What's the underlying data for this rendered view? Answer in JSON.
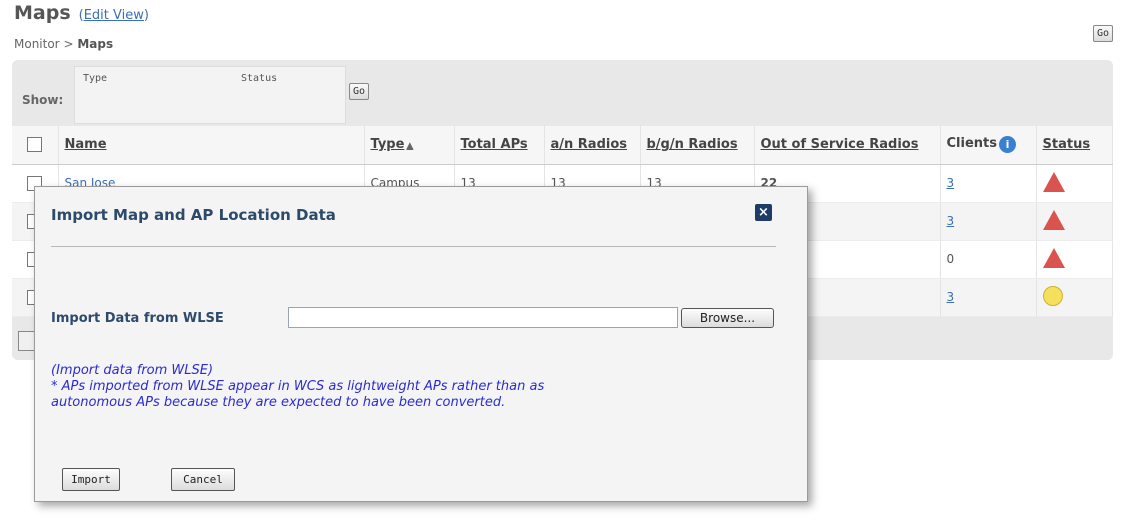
{
  "header": {
    "title": "Maps",
    "edit_view": "Edit View",
    "breadcrumb_parent": "Monitor",
    "breadcrumb_sep": " > ",
    "breadcrumb_current": "Maps",
    "go_label": "Go"
  },
  "filter": {
    "show_label": "Show:",
    "type_label": "Type",
    "status_label": "Status",
    "go_label": "Go"
  },
  "table": {
    "columns": [
      "Name",
      "Type",
      "Total APs",
      "a/n Radios",
      "b/g/n Radios",
      "Out of Service Radios",
      "Clients",
      "Status"
    ],
    "rows": [
      {
        "name": "San Jose",
        "type": "Campus",
        "total_aps": "13",
        "an_radios": "13",
        "bgn_radios": "13",
        "oos": "22",
        "clients": "3",
        "status": "critical"
      },
      {
        "name": "",
        "type": "",
        "total_aps": "",
        "an_radios": "",
        "bgn_radios": "",
        "oos": "",
        "clients": "3",
        "status": "critical"
      },
      {
        "name": "",
        "type": "",
        "total_aps": "",
        "an_radios": "",
        "bgn_radios": "",
        "oos": "",
        "clients": "0",
        "status": "critical"
      },
      {
        "name": "",
        "type": "",
        "total_aps": "",
        "an_radios": "",
        "bgn_radios": "",
        "oos": "",
        "clients": "3",
        "status": "minor"
      }
    ]
  },
  "modal": {
    "title": "Import Map and AP Location Data",
    "close_label": "×",
    "import_label": "Import Data from WLSE",
    "input_value": "",
    "browse_label": "Browse...",
    "note_line1": "(Import data from WLSE)",
    "note_line2": "* APs imported from WLSE appear in WCS as lightweight APs rather than as",
    "note_line3": "autonomous APs because they are expected to have been converted.",
    "import_button": "Import",
    "cancel_button": "Cancel"
  },
  "colors": {
    "link": "#3b6fb6",
    "critical": "#d9534f",
    "minor": "#f5e05c",
    "modal_title": "#2d4a6b",
    "note": "#2b2bd6"
  }
}
